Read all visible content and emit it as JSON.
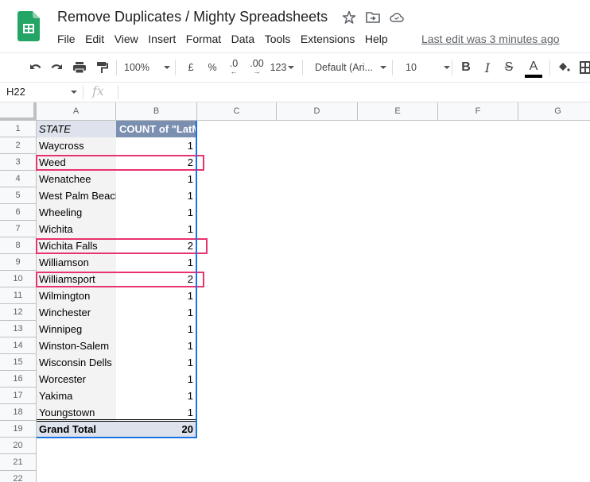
{
  "app": {
    "title": "Remove Duplicates / Mighty Spreadsheets",
    "last_edit": "Last edit was 3 minutes ago",
    "brand_color": "#0f9d58"
  },
  "menu": [
    "File",
    "Edit",
    "View",
    "Insert",
    "Format",
    "Data",
    "Tools",
    "Extensions",
    "Help"
  ],
  "toolbar": {
    "zoom": "100%",
    "currency": "£",
    "percent": "%",
    "decrease_decimals": ".0",
    "increase_decimals": ".00",
    "more_formats": "123",
    "font": "Default (Ari...",
    "font_size": "10",
    "bold": "B",
    "italic": "I",
    "strikethrough": "S",
    "text_color": "A"
  },
  "formula_bar": {
    "name_box": "H22",
    "fx": "fx",
    "value": ""
  },
  "columns": [
    "A",
    "B",
    "C",
    "D",
    "E",
    "F",
    "G"
  ],
  "row_numbers": [
    "1",
    "2",
    "3",
    "4",
    "5",
    "6",
    "7",
    "8",
    "9",
    "10",
    "11",
    "12",
    "13",
    "14",
    "15",
    "16",
    "17",
    "18",
    "19",
    "20",
    "21",
    "22"
  ],
  "pivot": {
    "header": {
      "a": "STATE",
      "b": "COUNT of \"LatM"
    },
    "rows": [
      {
        "state": "Waycross",
        "count": "1",
        "highlight": false
      },
      {
        "state": "Weed",
        "count": "2",
        "highlight": true
      },
      {
        "state": "Wenatchee",
        "count": "1",
        "highlight": false
      },
      {
        "state": "West Palm Beach",
        "count": "1",
        "highlight": false
      },
      {
        "state": "Wheeling",
        "count": "1",
        "highlight": false
      },
      {
        "state": "Wichita",
        "count": "1",
        "highlight": false
      },
      {
        "state": "Wichita Falls",
        "count": "2",
        "highlight": true
      },
      {
        "state": "Williamson",
        "count": "1",
        "highlight": false
      },
      {
        "state": "Williamsport",
        "count": "2",
        "highlight": true
      },
      {
        "state": "Wilmington",
        "count": "1",
        "highlight": false
      },
      {
        "state": "Winchester",
        "count": "1",
        "highlight": false
      },
      {
        "state": "Winnipeg",
        "count": "1",
        "highlight": false
      },
      {
        "state": "Winston-Salem",
        "count": "1",
        "highlight": false
      },
      {
        "state": "Wisconsin Dells",
        "count": "1",
        "highlight": false
      },
      {
        "state": "Worcester",
        "count": "1",
        "highlight": false
      },
      {
        "state": "Yakima",
        "count": "1",
        "highlight": false
      },
      {
        "state": "Youngstown",
        "count": "1",
        "highlight": false
      }
    ],
    "total": {
      "label": "Grand Total",
      "value": "20"
    },
    "highlight_color": "#e8336c",
    "selection_color": "#1a73e8"
  }
}
